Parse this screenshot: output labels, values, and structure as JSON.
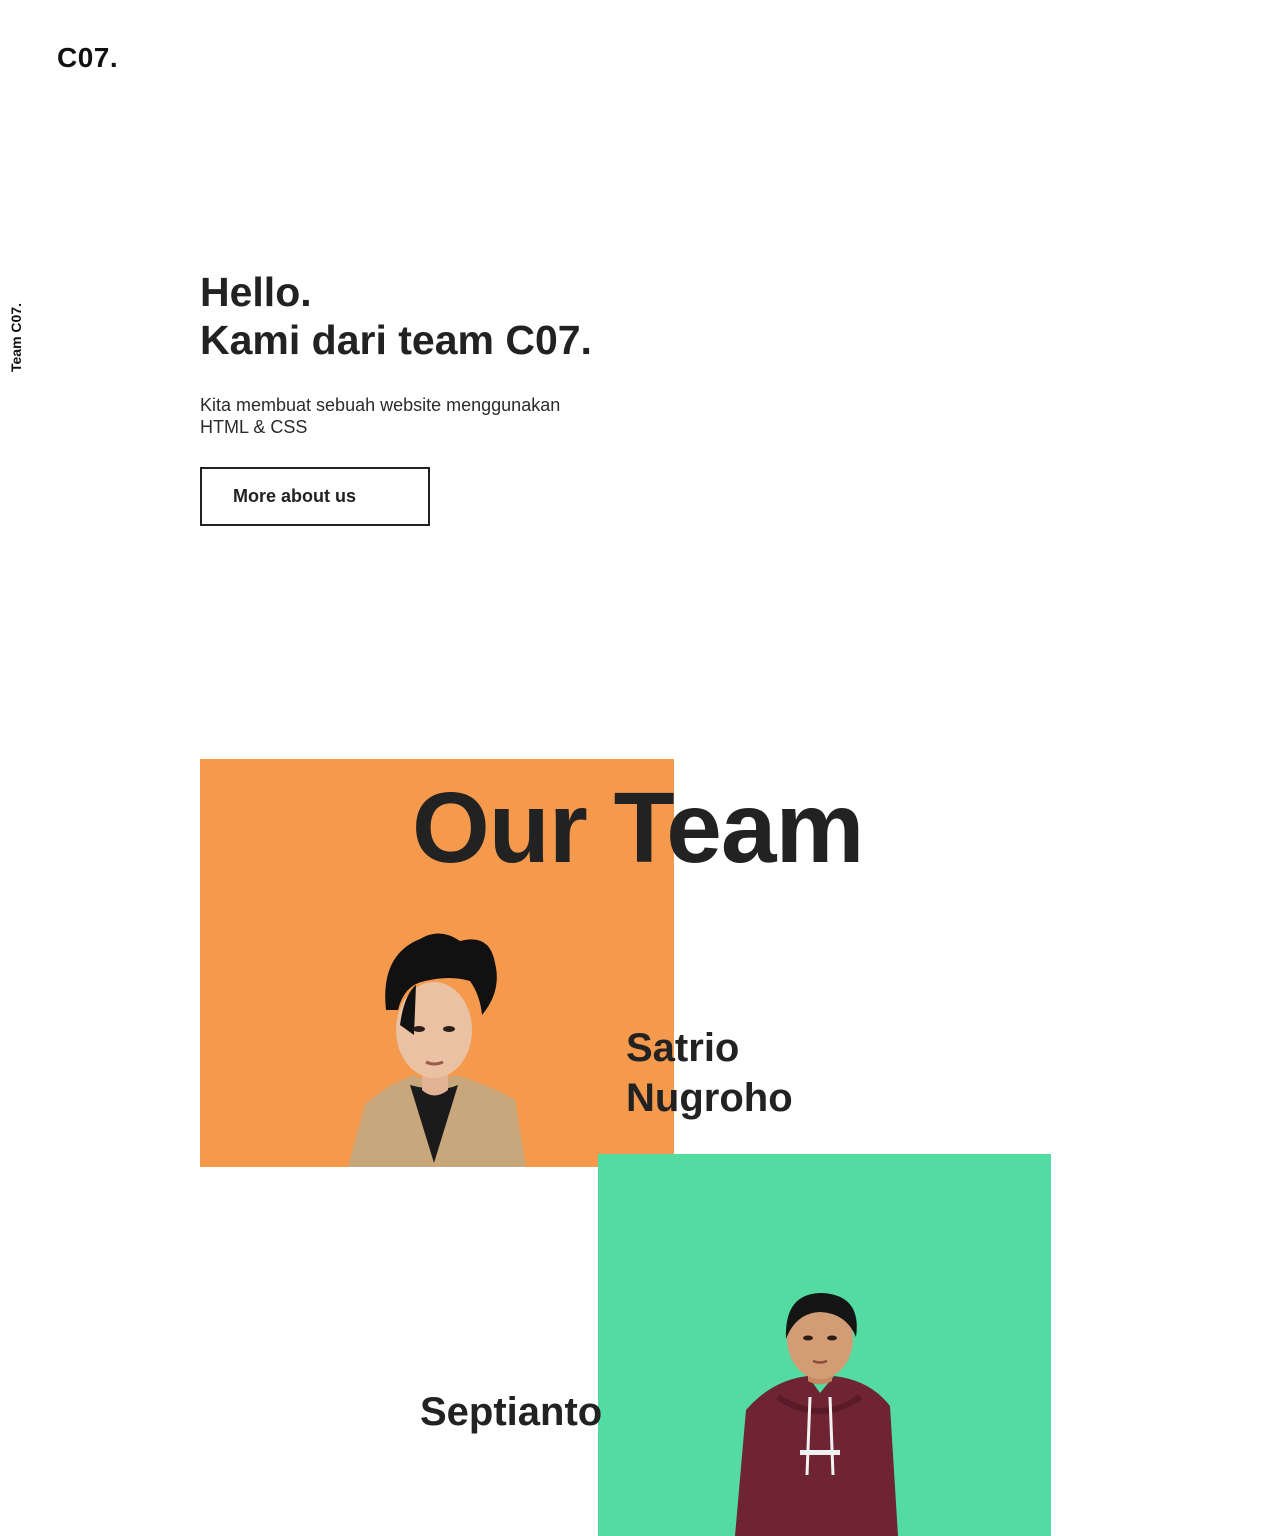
{
  "brand": {
    "logo_text": "C07.",
    "side_text": "Team C07."
  },
  "hero": {
    "title_line1": "Hello.",
    "title_line2": "Kami dari team C07.",
    "description_line1": "Kita membuat sebuah website menggunakan",
    "description_line2": "HTML & CSS",
    "cta_label": "More about us"
  },
  "team": {
    "heading": "Our Team",
    "members": [
      {
        "name_line1": "Satrio",
        "name_line2": "Nugroho",
        "accent_color": "#f5994d"
      },
      {
        "name_line1": "Septianto",
        "accent_color": "#53dba2"
      }
    ]
  }
}
